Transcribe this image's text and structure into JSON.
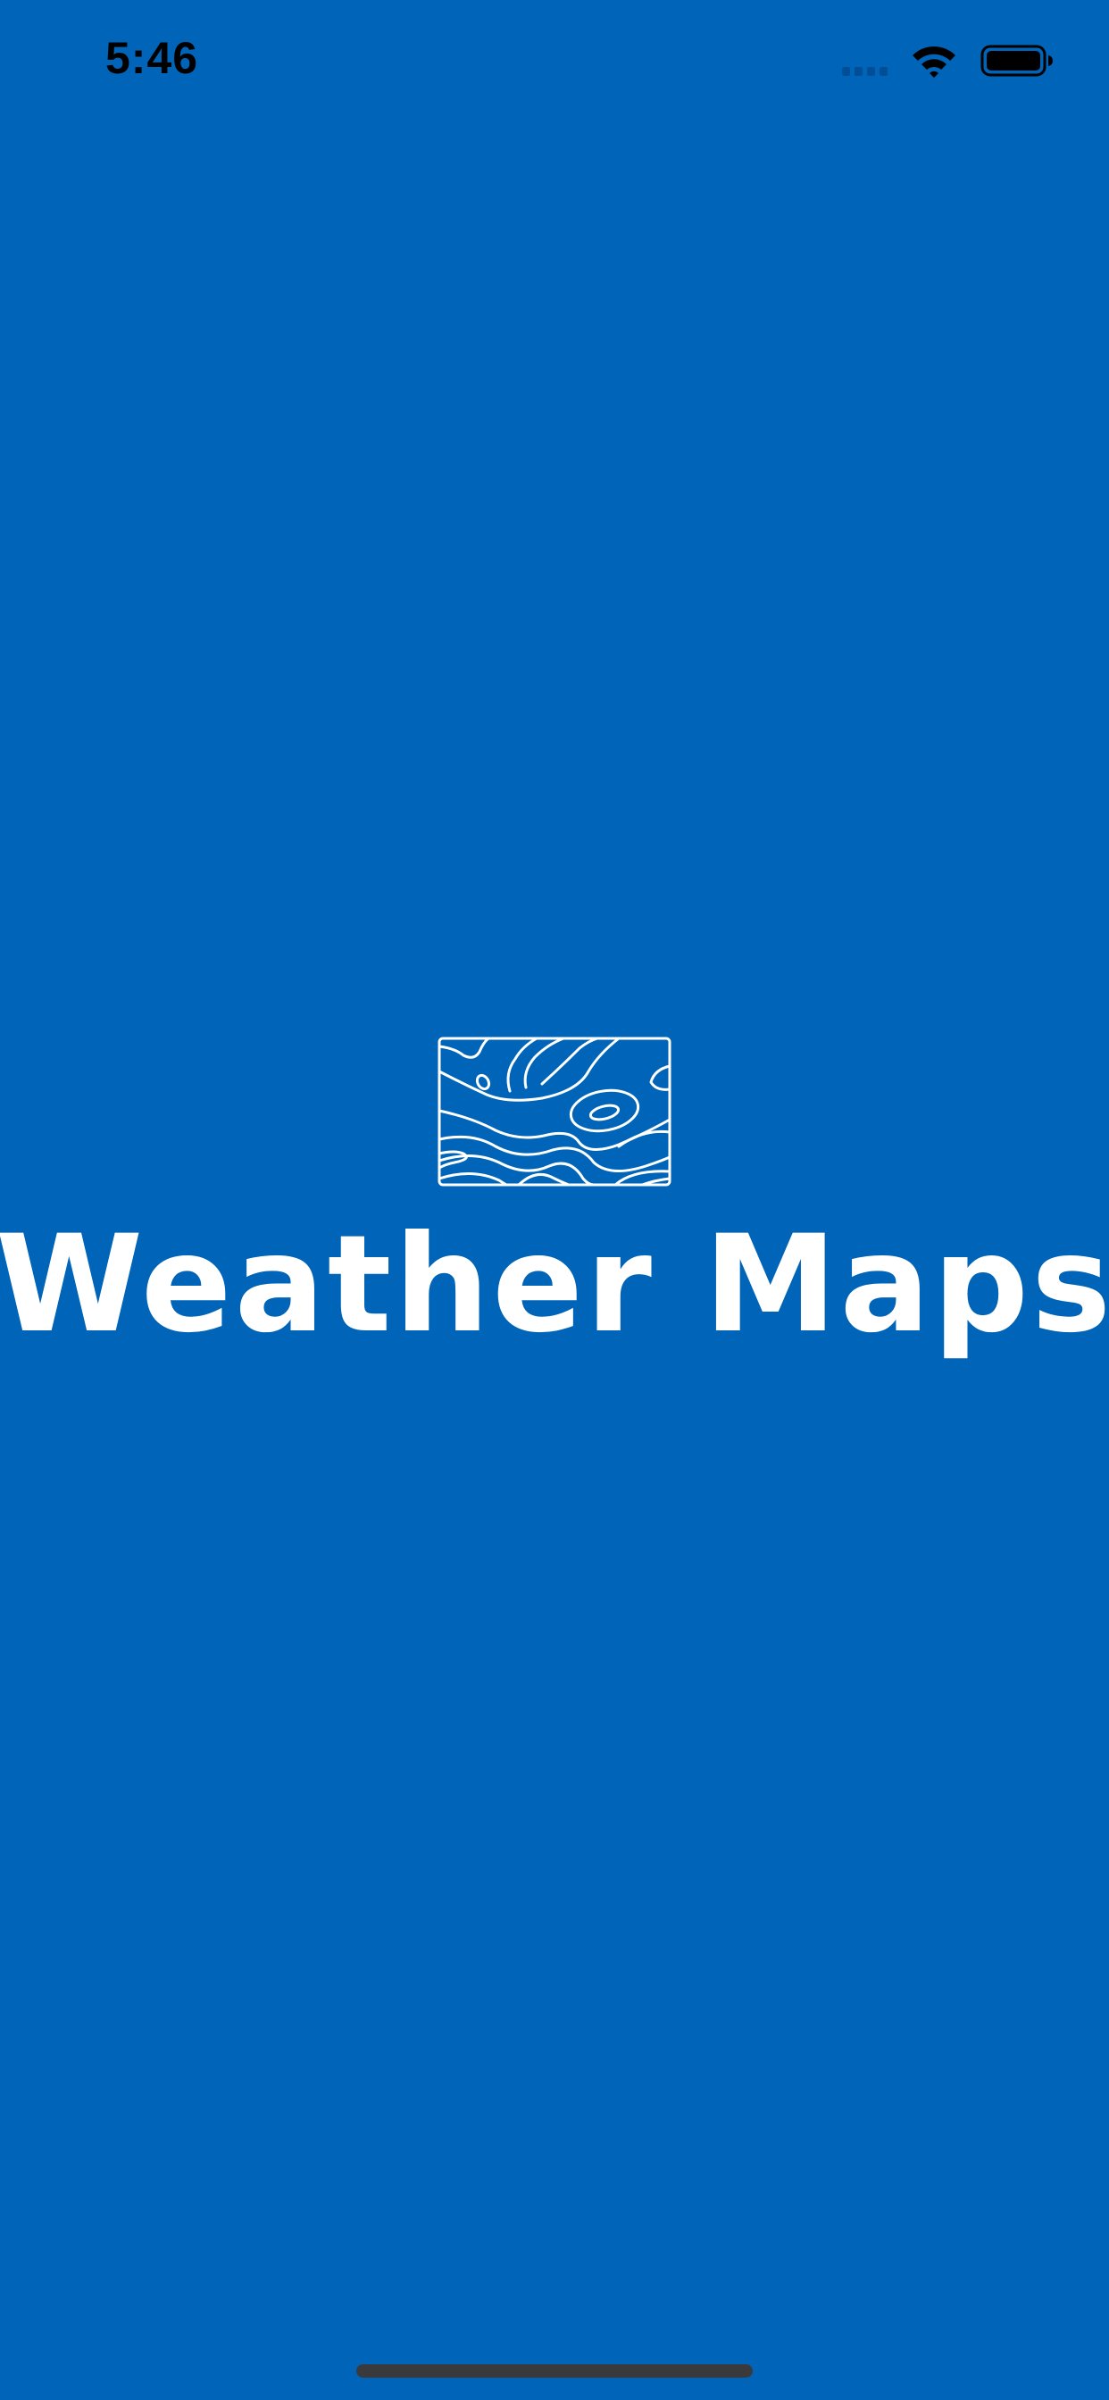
{
  "status_bar": {
    "time": "5:46",
    "icons": [
      "cellular-signal-icon",
      "wifi-icon",
      "battery-icon"
    ]
  },
  "splash": {
    "logo_icon": "contour-map-icon",
    "app_name": "Weather Maps"
  },
  "colors": {
    "background": "#0064B9",
    "foreground": "#FFFFFF",
    "status_text": "#000000",
    "home_indicator": "#3A3A3C"
  }
}
